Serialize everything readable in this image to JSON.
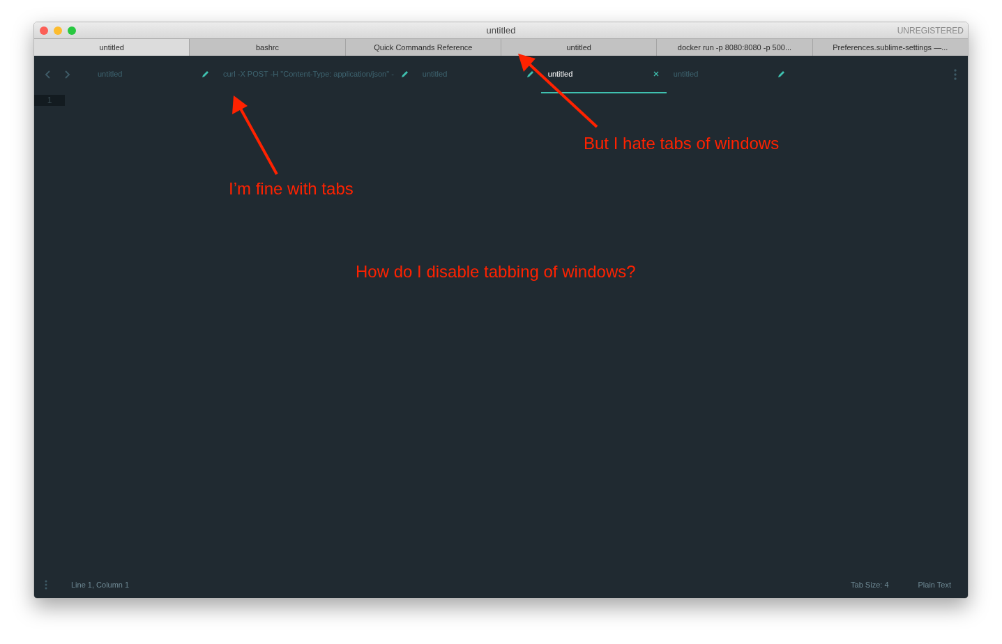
{
  "window": {
    "title": "untitled",
    "badge": "UNREGISTERED"
  },
  "window_tabs": [
    {
      "label": "untitled",
      "selected": true
    },
    {
      "label": "bashrc",
      "selected": false
    },
    {
      "label": "Quick Commands Reference",
      "selected": false
    },
    {
      "label": "untitled",
      "selected": false
    },
    {
      "label": "docker run -p 8080:8080 -p 500...",
      "selected": false
    },
    {
      "label": "Preferences.sublime-settings —...",
      "selected": false
    }
  ],
  "editor_tabs": [
    {
      "label": "untitled",
      "selected": false
    },
    {
      "label": "curl -X POST -H \"Content-Type: application/json\" -",
      "selected": false
    },
    {
      "label": "untitled",
      "selected": false
    },
    {
      "label": "untitled",
      "selected": true
    },
    {
      "label": "untitled",
      "selected": false
    }
  ],
  "gutter": {
    "line_number": "1"
  },
  "status_bar": {
    "position": "Line 1, Column 1",
    "tab_size": "Tab Size: 4",
    "syntax": "Plain Text"
  },
  "annotations": [
    "I’m fine with tabs",
    "But I hate tabs of windows",
    "How do I disable tabbing of windows?"
  ]
}
